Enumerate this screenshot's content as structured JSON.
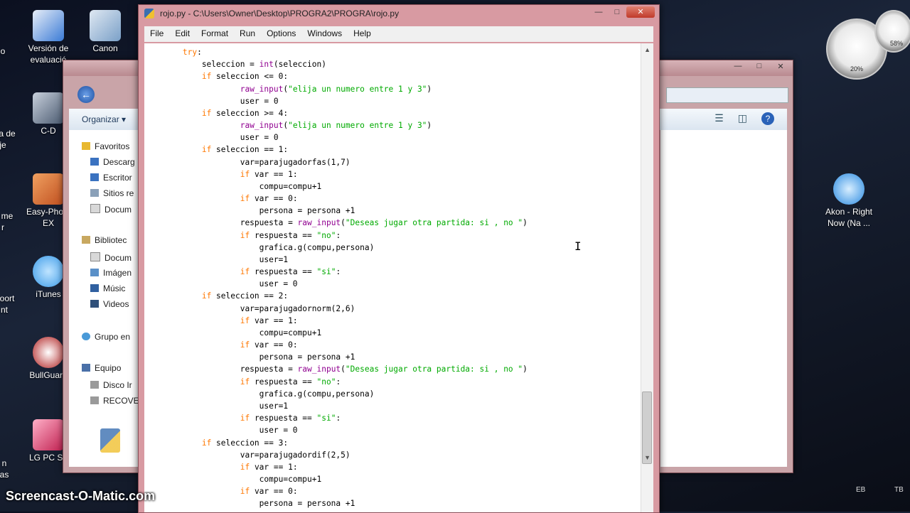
{
  "desktop": {
    "icons": [
      {
        "label": "Versión de evaluació",
        "color": "#3b7bd6"
      },
      {
        "label": "Canon",
        "color": "#7aa0c8"
      },
      {
        "label": "C-D",
        "color": "#4a5a70"
      },
      {
        "label": "Easy-Photo EX",
        "color": "#c05020"
      },
      {
        "label": "iTunes",
        "color": "#3a9ae8"
      },
      {
        "label": "BullGuard",
        "color": "#b02020"
      },
      {
        "label": "LG PC Su",
        "color": "#c02050"
      },
      {
        "label": "Akon - Right Now (Na ...",
        "color": "#2a8ae0"
      }
    ],
    "edge_labels": [
      "o",
      "a de",
      "je",
      "me",
      "r",
      "oort",
      "nt",
      "n",
      "as"
    ]
  },
  "explorer": {
    "organize_label": "Organizar ▾",
    "nav_items": [
      "Favoritos",
      "Descarg",
      "Escritor",
      "Sitios re",
      "Docum",
      "Bibliotec",
      "Docum",
      "Imágen",
      "Músic",
      "Videos",
      "Grupo en",
      "Equipo",
      "Disco Ir",
      "RECOVE"
    ],
    "back_icon": "←"
  },
  "idle": {
    "title": "rojo.py - C:\\Users\\Owner\\Desktop\\PROGRA2\\PROGRA\\rojo.py",
    "menu": [
      "File",
      "Edit",
      "Format",
      "Run",
      "Options",
      "Windows",
      "Help"
    ],
    "code": [
      [
        [
          "",
          "        "
        ],
        [
          "kw",
          "try"
        ],
        [
          "",
          ":"
        ]
      ],
      [
        [
          "",
          "            seleccion = "
        ],
        [
          "bi",
          "int"
        ],
        [
          "",
          "(seleccion)"
        ]
      ],
      [
        [
          "",
          "            "
        ],
        [
          "kw",
          "if"
        ],
        [
          "",
          " seleccion <= 0:"
        ]
      ],
      [
        [
          "",
          "                    "
        ],
        [
          "bi",
          "raw_input"
        ],
        [
          "",
          "("
        ],
        [
          "str",
          "\"elija un numero entre 1 y 3\""
        ],
        [
          "",
          ")"
        ]
      ],
      [
        [
          "",
          "                    user = 0"
        ]
      ],
      [
        [
          "",
          "            "
        ],
        [
          "kw",
          "if"
        ],
        [
          "",
          " seleccion >= 4:"
        ]
      ],
      [
        [
          "",
          "                    "
        ],
        [
          "bi",
          "raw_input"
        ],
        [
          "",
          "("
        ],
        [
          "str",
          "\"elija un numero entre 1 y 3\""
        ],
        [
          "",
          ")"
        ]
      ],
      [
        [
          "",
          "                    user = 0"
        ]
      ],
      [
        [
          "",
          "            "
        ],
        [
          "kw",
          "if"
        ],
        [
          "",
          " seleccion == 1:"
        ]
      ],
      [
        [
          "",
          "                    var=parajugadorfas(1,7)"
        ]
      ],
      [
        [
          "",
          "                    "
        ],
        [
          "kw",
          "if"
        ],
        [
          "",
          " var == 1:"
        ]
      ],
      [
        [
          "",
          "                        compu=compu+1"
        ]
      ],
      [
        [
          "",
          "                    "
        ],
        [
          "kw",
          "if"
        ],
        [
          "",
          " var == 0:"
        ]
      ],
      [
        [
          "",
          "                        persona = persona +1"
        ]
      ],
      [
        [
          "",
          "                    respuesta = "
        ],
        [
          "bi",
          "raw_input"
        ],
        [
          "",
          "("
        ],
        [
          "str",
          "\"Deseas jugar otra partida: si , no \""
        ],
        [
          "",
          ")"
        ]
      ],
      [
        [
          "",
          "                    "
        ],
        [
          "kw",
          "if"
        ],
        [
          "",
          " respuesta == "
        ],
        [
          "str",
          "\"no\""
        ],
        [
          "",
          ":"
        ]
      ],
      [
        [
          "",
          "                        grafica.g(compu,persona)"
        ]
      ],
      [
        [
          "",
          "                        user=1"
        ]
      ],
      [
        [
          "",
          "                    "
        ],
        [
          "kw",
          "if"
        ],
        [
          "",
          " respuesta == "
        ],
        [
          "str",
          "\"si\""
        ],
        [
          "",
          ":"
        ]
      ],
      [
        [
          "",
          "                        user = 0"
        ]
      ],
      [
        [
          "",
          "            "
        ],
        [
          "kw",
          "if"
        ],
        [
          "",
          " seleccion == 2:"
        ]
      ],
      [
        [
          "",
          "                    var=parajugadornorm(2,6)"
        ]
      ],
      [
        [
          "",
          "                    "
        ],
        [
          "kw",
          "if"
        ],
        [
          "",
          " var == 1:"
        ]
      ],
      [
        [
          "",
          "                        compu=compu+1"
        ]
      ],
      [
        [
          "",
          "                    "
        ],
        [
          "kw",
          "if"
        ],
        [
          "",
          " var == 0:"
        ]
      ],
      [
        [
          "",
          "                        persona = persona +1"
        ]
      ],
      [
        [
          "",
          "                    respuesta = "
        ],
        [
          "bi",
          "raw_input"
        ],
        [
          "",
          "("
        ],
        [
          "str",
          "\"Deseas jugar otra partida: si , no \""
        ],
        [
          "",
          ")"
        ]
      ],
      [
        [
          "",
          "                    "
        ],
        [
          "kw",
          "if"
        ],
        [
          "",
          " respuesta == "
        ],
        [
          "str",
          "\"no\""
        ],
        [
          "",
          ":"
        ]
      ],
      [
        [
          "",
          "                        grafica.g(compu,persona)"
        ]
      ],
      [
        [
          "",
          "                        user=1"
        ]
      ],
      [
        [
          "",
          "                    "
        ],
        [
          "kw",
          "if"
        ],
        [
          "",
          " respuesta == "
        ],
        [
          "str",
          "\"si\""
        ],
        [
          "",
          ":"
        ]
      ],
      [
        [
          "",
          "                        user = 0"
        ]
      ],
      [
        [
          "",
          "            "
        ],
        [
          "kw",
          "if"
        ],
        [
          "",
          " seleccion == 3:"
        ]
      ],
      [
        [
          "",
          "                    var=parajugadordif(2,5)"
        ]
      ],
      [
        [
          "",
          "                    "
        ],
        [
          "kw",
          "if"
        ],
        [
          "",
          " var == 1:"
        ]
      ],
      [
        [
          "",
          "                        compu=compu+1"
        ]
      ],
      [
        [
          "",
          "                    "
        ],
        [
          "kw",
          "if"
        ],
        [
          "",
          " var == 0:"
        ]
      ],
      [
        [
          "",
          "                        persona = persona +1"
        ]
      ]
    ]
  },
  "widgets": {
    "cpu_label": "20%",
    "mem_label": "58%"
  },
  "tray": {
    "a": "EB",
    "b": "TB"
  },
  "watermark": "Screencast-O-Matic.com"
}
